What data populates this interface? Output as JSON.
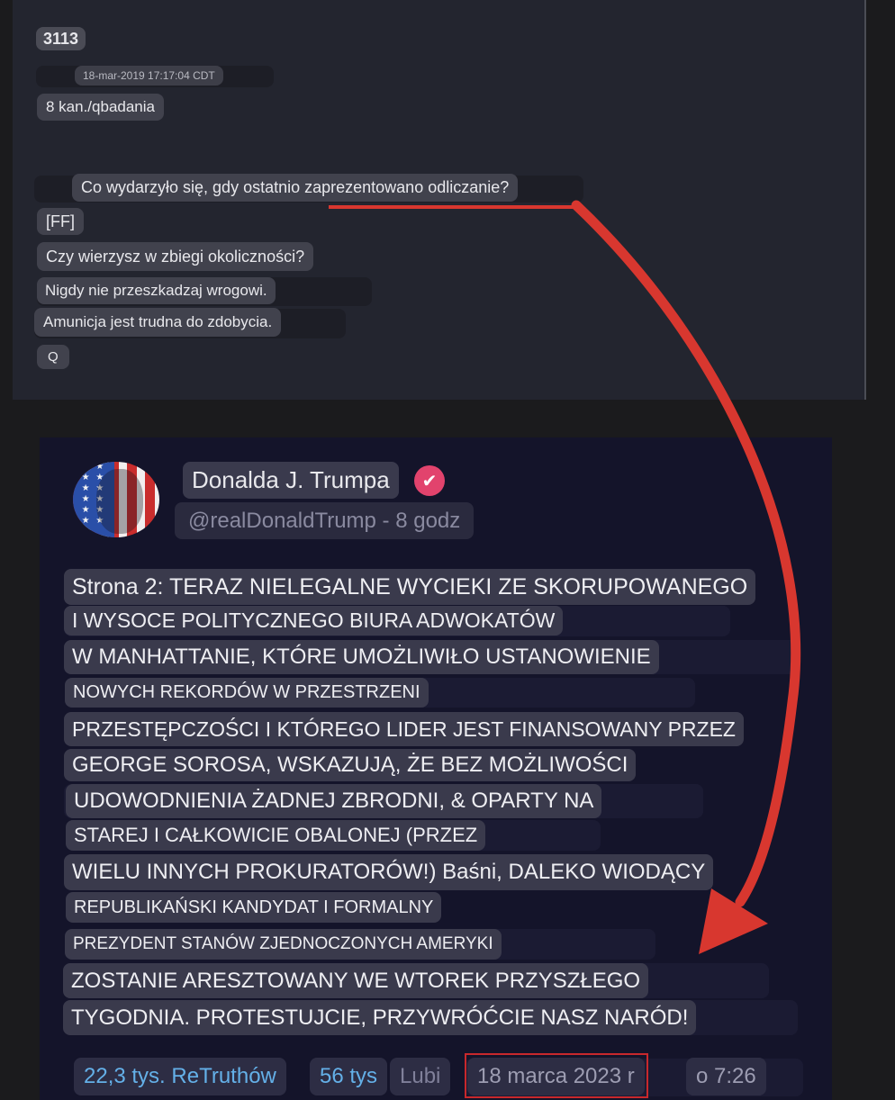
{
  "qpost": {
    "number": "3113",
    "timestamp": "18-mar-2019 17:17:04 CDT",
    "board": "8 kan./qbadania",
    "lines": [
      "Co wydarzyło się, gdy ostatnio zaprezentowano odliczanie?",
      "[FF]",
      "Czy wierzysz w zbiegi okoliczności?",
      "Nigdy nie przeszkadzaj wrogowi.",
      "Amunicja jest trudna do zdobycia."
    ],
    "signature": "Q"
  },
  "truth_post": {
    "author_name": "Donalda J. Trumpa",
    "verified_icon": "check-badge-icon",
    "handle_time": "@realDonaldTrump - 8 godz",
    "lines": [
      "Strona 2: TERAZ NIELEGALNE WYCIEKI ZE SKORUPOWANEGO",
      "I WYSOCE POLITYCZNEGO BIURA ADWOKATÓW",
      "W MANHATTANIE, KTÓRE UMOŻLIWIŁO USTANOWIENIE",
      "NOWYCH REKORDÓW W PRZESTRZENI",
      "PRZESTĘPCZOŚCI I KTÓREGO LIDER JEST FINANSOWANY PRZEZ",
      "GEORGE SOROSA, WSKAZUJĄ, ŻE BEZ MOŻLIWOŚCI",
      "UDOWODNIENIA ŻADNEJ ZBRODNI, & OPARTY NA",
      "STAREJ I CAŁKOWICIE OBALONEJ (PRZEZ",
      "WIELU INNYCH PROKURATORÓW!) Baśni, DALEKO WIODĄCY",
      "REPUBLIKAŃSKI KANDYDAT I FORMALNY",
      "PREZYDENT STANÓW ZJEDNOCZONYCH AMERYKI",
      "ZOSTANIE ARESZTOWANY WE WTOREK PRZYSZŁEGO",
      "TYGODNIA. PROTESTUJCIE, PRZYWRÓĆCIE NASZ NARÓD!"
    ],
    "stats": {
      "retruths": "22,3 tys. ReTruthów",
      "likes_count": "56 tys",
      "likes_label": "Lubi",
      "date": "18 marca 2023 r",
      "time": "o 7:26"
    }
  },
  "colors": {
    "arrow": "#d8372f",
    "highlight_box": "#c8282c",
    "link_blue": "#64b0e8",
    "verified_badge": "#e2436d"
  }
}
